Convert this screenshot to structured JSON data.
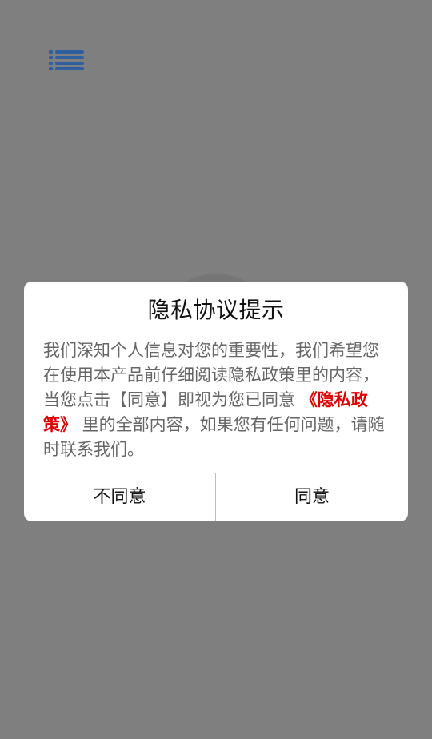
{
  "screen": {
    "background_color": "#7f7f7f",
    "menu_icon": "list-icon",
    "menu_icon_color": "#2f5f9f"
  },
  "dialog": {
    "title": "隐私协议提示",
    "message_before_link": "我们深知个人信息对您的重要性，我们希望您在使用本产品前仔细阅读隐私政策里的内容，当您点击【同意】即视为您已同意 ",
    "policy_link": "《隐私政策》",
    "message_after_link": " 里的全部内容，如果您有任何问题，请随时联系我们。",
    "disagree_label": "不同意",
    "agree_label": "同意",
    "link_color": "#e00000"
  }
}
